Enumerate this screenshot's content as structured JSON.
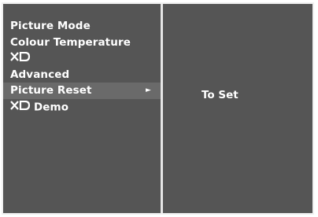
{
  "menu": {
    "items": [
      {
        "label": "Picture Mode"
      },
      {
        "label": "Colour Temperature"
      },
      {
        "label": "XD",
        "logo": true
      },
      {
        "label": "Advanced"
      },
      {
        "label": "Picture Reset",
        "selected": true,
        "arrow": "►"
      },
      {
        "label": "Demo",
        "logo_prefix": "XD"
      }
    ]
  },
  "submenu": {
    "value": "To Set"
  },
  "icons": {
    "xd": "xd-logo-icon",
    "arrow": "arrow-right-icon"
  },
  "colors": {
    "background": "#555555",
    "text": "#ffffff",
    "border": "#f0f0f0"
  }
}
